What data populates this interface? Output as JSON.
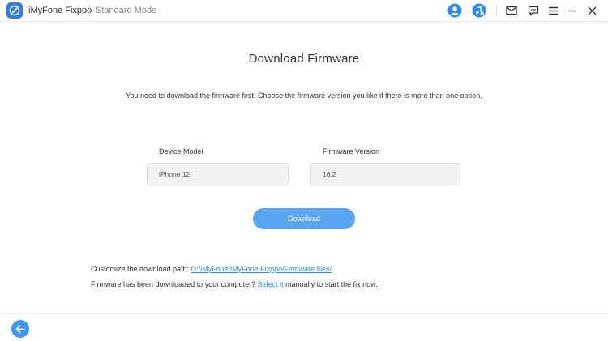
{
  "titlebar": {
    "app_name": "iMyFone Fixppo",
    "mode": "Standard Mode",
    "icons": [
      "logo-icon",
      "account-icon",
      "music-search-icon",
      "mail-icon",
      "feedback-icon",
      "menu-icon",
      "minimize-icon",
      "close-icon"
    ]
  },
  "main": {
    "title": "Download Firmware",
    "instruction": "You need to download the firmware first. Choose the firmware version you like if there is more than one option.",
    "device_model": {
      "label": "Device Model",
      "value": "iPhone 12"
    },
    "firmware_version": {
      "label": "Firmware Version",
      "value": "16.2"
    },
    "download_label": "Download",
    "path_text": "Customize the download path: ",
    "path_link": "D:/iMyFone/iMyFone Fixppo/Firmware files/",
    "downloaded_text": "Firmware has been downloaded to your computer? ",
    "select_link": "Select it",
    "downloaded_suffix": " manually to start the fix now."
  },
  "footer": {
    "back_icon": "back-arrow-icon"
  },
  "colors": {
    "accent": "#3f95f0",
    "button": "#5aa5f1",
    "link": "#2f8bf0",
    "field_bg": "#f3f3f3"
  }
}
